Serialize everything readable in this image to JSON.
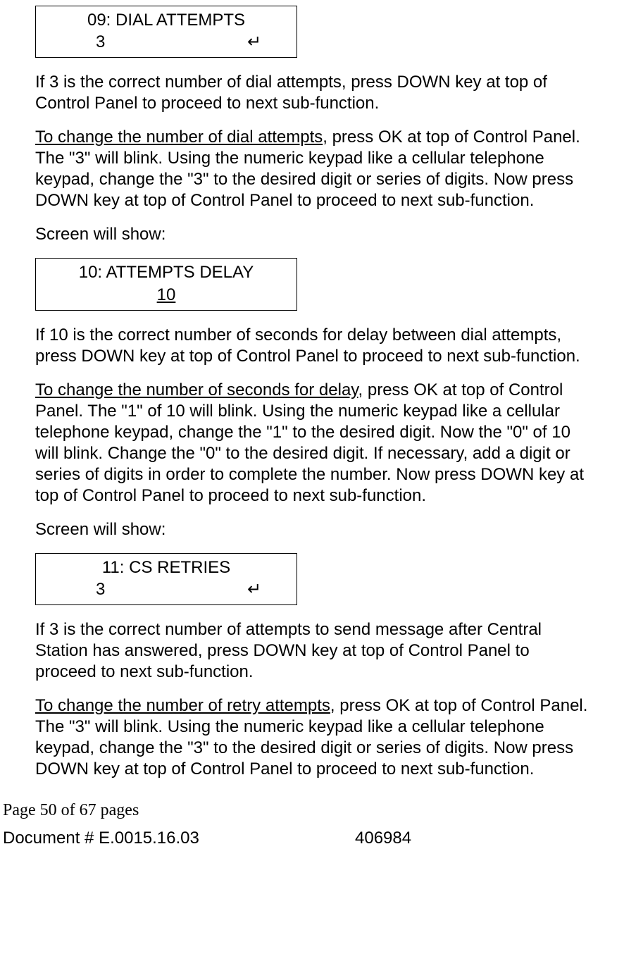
{
  "screen1": {
    "title": "09: DIAL ATTEMPTS",
    "value": "3",
    "symbol": "↵"
  },
  "p1": "If 3 is the correct number of dial attempts, press DOWN key at top of Control Panel to proceed to next sub-function.",
  "p2a": "To change the number of dial attempts",
  "p2b": ", press OK at top of Control Panel. The \"3\" will blink. Using the numeric keypad like a cellular telephone keypad, change the \"3\" to the desired digit or series of digits. Now press DOWN key at top of Control Panel to proceed to next sub-function.",
  "p3": "Screen will show:",
  "screen2": {
    "title": "10: ATTEMPTS DELAY",
    "value": "10"
  },
  "p4": "If 10 is the correct number of seconds for delay between dial attempts, press DOWN key at top of Control Panel to proceed to next sub-function.",
  "p5a": "To change the number of seconds for delay",
  "p5b": ", press OK at top of Control Panel. The \"1\" of 10 will blink. Using the numeric keypad like a cellular telephone keypad, change the \"1\" to the desired digit. Now the \"0\" of 10 will blink. Change the \"0\" to the desired digit. If necessary, add a digit or series of digits in order to complete the number. Now press DOWN key at top of Control Panel to proceed to next sub-function.",
  "p6": "Screen will show:",
  "screen3": {
    "title": "11: CS RETRIES",
    "value": "3",
    "symbol": "↵"
  },
  "p7": "If 3 is the correct number of attempts to send message after Central Station has answered, press DOWN key at top of Control Panel to proceed to next sub-function.",
  "p8a": "To change the number of retry attempts",
  "p8b": ", press OK at top of Control Panel. The \"3\" will blink. Using the numeric keypad like a cellular telephone keypad, change the \"3\" to the desired digit or series of digits. Now press DOWN key at top of Control Panel to proceed to next sub-function.",
  "footer": {
    "page": "Page 50 of  67 pages",
    "doc": "Document # E.0015.16.03",
    "num": "406984"
  }
}
